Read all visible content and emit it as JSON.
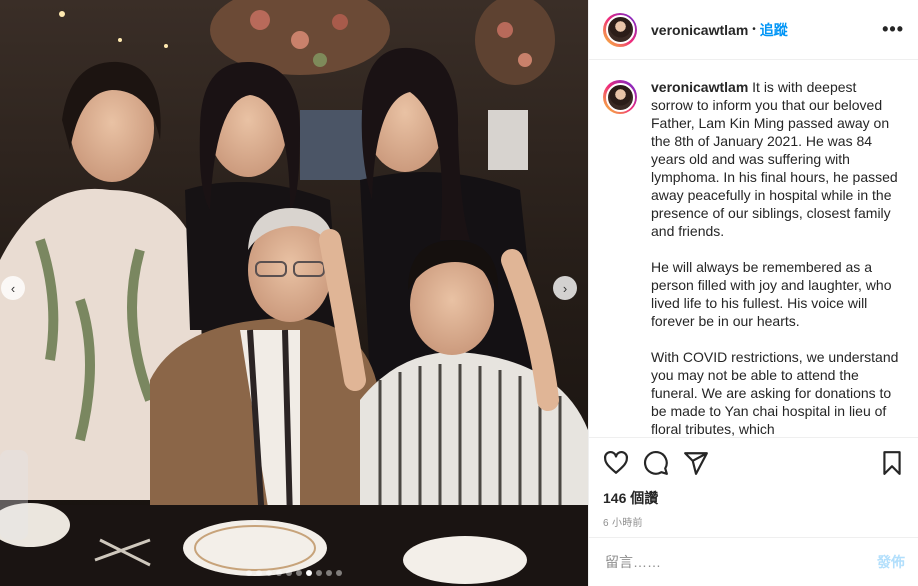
{
  "header": {
    "username": "veronicawtlam",
    "separator": "•",
    "follow_label": "追蹤",
    "more_label": "•••"
  },
  "caption": {
    "username": "veronicawtlam",
    "paragraphs": [
      "It is with deepest sorrow to inform you that our beloved Father, Lam Kin Ming passed away on the 8th of January 2021. He was 84 years old and was suffering with lymphoma. In his final hours, he passed away peacefully in hospital while in the presence of our siblings, closest family and friends.",
      "He will always be remembered as a person filled with joy and laughter, who lived life to his fullest. His voice will forever be in our hearts.",
      "With COVID restrictions, we understand you may not be able to attend the funeral. We are asking for donations to be made to Yan chai hospital in lieu of floral tributes, which"
    ]
  },
  "stats": {
    "views": "146 個讚",
    "time": "6 小時前"
  },
  "comment": {
    "placeholder": "留言……",
    "post_label": "發佈"
  },
  "carousel": {
    "prev": "‹",
    "next": "›",
    "dots": 10,
    "active_dot": 6
  },
  "colors": {
    "link": "#0095f6",
    "post_disabled": "#b2dffc",
    "muted": "#8e8e8e"
  }
}
